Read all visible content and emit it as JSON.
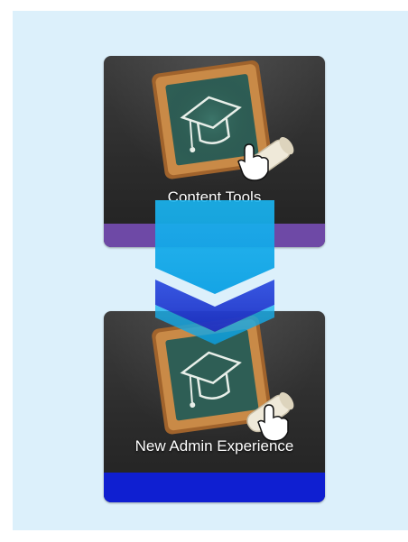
{
  "tiles": [
    {
      "label": "Content Tools",
      "icon": "chalkboard-graduation-cap-icon",
      "accent_color": "#6e49a6"
    },
    {
      "label": "New Admin Experience",
      "icon": "chalkboard-graduation-cap-icon",
      "accent_color": "#0f1fd1"
    }
  ],
  "transition_icon": "chevron-down-arrows-icon",
  "colors": {
    "background_panel": "#dcf0fb",
    "arrow_light": "#1ab3ee",
    "arrow_dark": "#2233cc"
  }
}
